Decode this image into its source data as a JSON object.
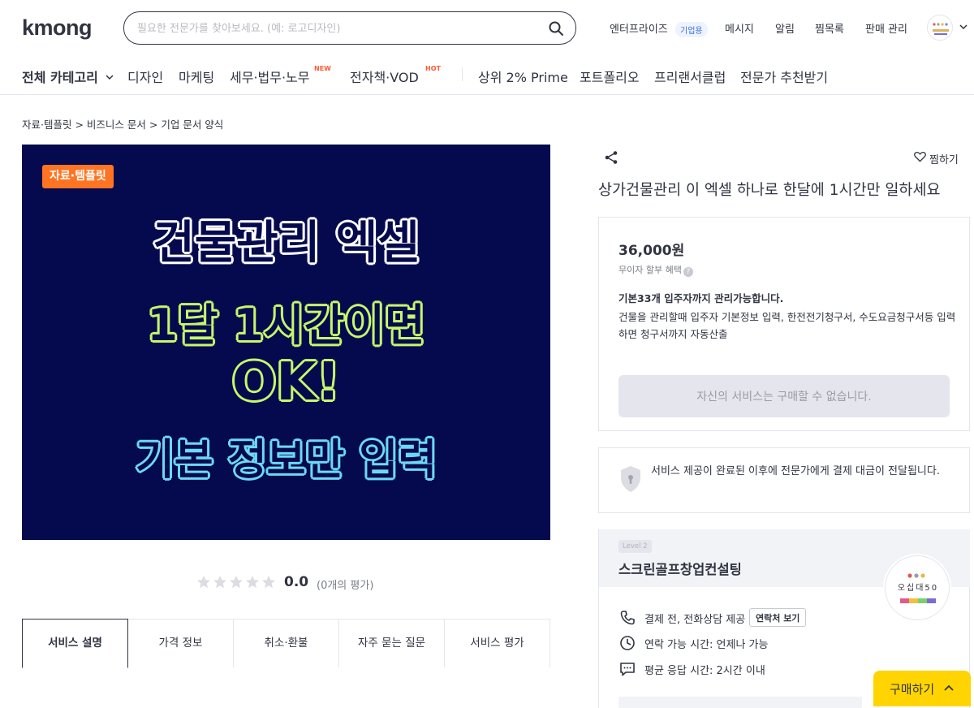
{
  "header": {
    "logo": "kmong",
    "search_placeholder": "필요한 전문가를 찾아보세요. (예: 로고디자인)",
    "nav": {
      "enterprise": "엔터프라이즈",
      "enterprise_badge": "기업용",
      "message": "메시지",
      "alarm": "알림",
      "favorites": "찜목록",
      "sales": "판매 관리"
    }
  },
  "category_nav": {
    "all": "전체 카테고리",
    "items": [
      "디자인",
      "마케팅",
      "세무·법무·노무",
      "전자책·VOD",
      "상위 2% Prime",
      "포트폴리오",
      "프리랜서클럽",
      "전문가 추천받기"
    ],
    "badge_new": "NEW",
    "badge_hot": "HOT"
  },
  "breadcrumb": [
    "자료·템플릿",
    "비즈니스 문서",
    "기업 문서 양식"
  ],
  "hero": {
    "tag": "자료·템플릿",
    "lines": [
      "건물관리 엑셀",
      "1달 1시간이면",
      "OK!",
      "기본 정보만 입력"
    ],
    "colors": {
      "bg": "#040a4d",
      "white": "#ffffff",
      "green": "#c6f86a",
      "cyan": "#6cd9f4",
      "tag": "#ff7422"
    }
  },
  "rating": {
    "score": "0.0",
    "count": "(0개의 평가)",
    "stars": 0
  },
  "tabs": [
    "서비스 설명",
    "가격 정보",
    "취소·환불",
    "자주 묻는 질문",
    "서비스 평가"
  ],
  "gig": {
    "share": "share-icon",
    "favorite_label": "찜하기",
    "title": "상가건물관리 이 엑셀 하나로 한달에 1시간만 일하세요",
    "price": "36,000원",
    "installment": "무이자 할부 혜택",
    "desc_title": "기본33개 입주자까지 관리가능합니다.",
    "desc_body": "건물을 관리할때 입주자 기본정보 입력, 한전전기청구서, 수도요금청구서등 입력하면 청구서까지 자동산출",
    "disabled_button": "자신의 서비스는 구매할 수 없습니다."
  },
  "guarantee": "서비스 제공이 완료된 이후에 전문가에게 결제 대금이 전달됩니다.",
  "expert": {
    "level": "Level 2",
    "name": "스크린골프창업컨설팅",
    "avatar_text": "오십대50",
    "rows": [
      "결제 전, 전화상담 제공",
      "연락 가능 시간: 언제나 가능",
      "평균 응답 시간: 2시간 이내"
    ],
    "contact_button": "연락처 보기"
  },
  "buy_button": "구매하기"
}
